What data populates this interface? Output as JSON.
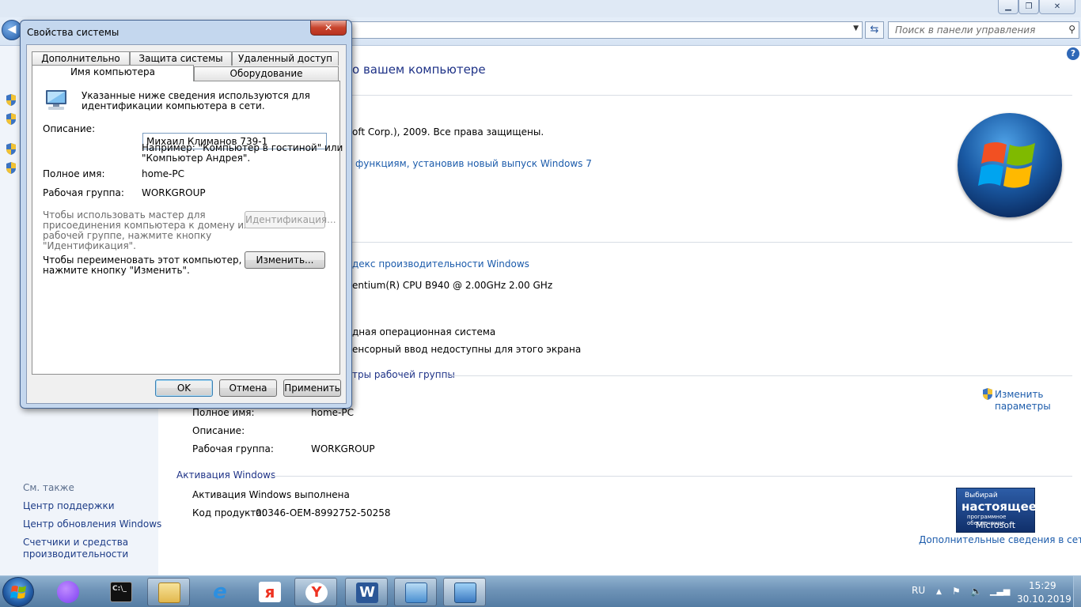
{
  "search": {
    "placeholder": "Поиск в панели управления"
  },
  "cp": {
    "heading_partial": "о вашем компьютере",
    "copyright_partial": "oft Corp.), 2009. Все права защищены.",
    "upgrade_link_partial": "функциям, установив новый выпуск Windows 7",
    "rating_link_partial": "декс производительности Windows",
    "cpu_partial": "entium(R) CPU B940 @ 2.00GHz   2.00 GHz",
    "os_type_partial": "дная операционная система",
    "pen_partial": "енсорный ввод недоступны для этого экрана",
    "section_name_partial": "тры рабочей группы",
    "full_name_label": "Полное имя:",
    "full_name_value": "home-PC",
    "description_label": "Описание:",
    "workgroup_label": "Рабочая группа:",
    "workgroup_value": "WORKGROUP",
    "change_settings_line1": "Изменить",
    "change_settings_line2": "параметры",
    "activation_section": "Активация Windows",
    "activation_status": "Активация Windows выполнена",
    "product_key_label": "Код продукта:",
    "product_key_value": "00346-OEM-8992752-50258",
    "more_info_link": "Дополнительные сведения в сети...",
    "genuine_badge": {
      "line1": "Выбирай",
      "line2": "настоящее",
      "line3": "программное обеспечение",
      "line4": "Microsoft"
    }
  },
  "sidebar": {
    "see_also": "См. также",
    "links": [
      "Центр поддержки",
      "Центр обновления Windows",
      "Счетчики и средства",
      "производительности"
    ]
  },
  "dialog": {
    "title": "Свойства системы",
    "close_glyph": "✕",
    "tabs_row1": [
      "Дополнительно",
      "Защита системы",
      "Удаленный доступ"
    ],
    "tabs_row2": [
      "Имя компьютера",
      "Оборудование"
    ],
    "intro_line1": "Указанные ниже сведения используются для",
    "intro_line2": "идентификации компьютера в сети.",
    "description_label": "Описание:",
    "description_value": "Михаил Климанов 739-1",
    "example_line1": "Например: \"Компьютер в гостиной\" или",
    "example_line2": "\"Компьютер Андрея\".",
    "full_name_label": "Полное имя:",
    "full_name_value": "home-PC",
    "workgroup_label": "Рабочая группа:",
    "workgroup_value": "WORKGROUP",
    "wizard_text": [
      "Чтобы использовать мастер для",
      "присоединения компьютера к домену или",
      "рабочей группе, нажмите кнопку",
      "\"Идентификация\"."
    ],
    "identify_button": "Идентификация...",
    "rename_text": [
      "Чтобы переименовать этот компьютер,",
      "нажмите кнопку \"Изменить\"."
    ],
    "change_button": "Изменить...",
    "ok_button": "OK",
    "cancel_button": "Отмена",
    "apply_button": "Применить"
  },
  "taskbar": {
    "language": "RU",
    "time": "15:29",
    "date": "30.10.2019"
  }
}
